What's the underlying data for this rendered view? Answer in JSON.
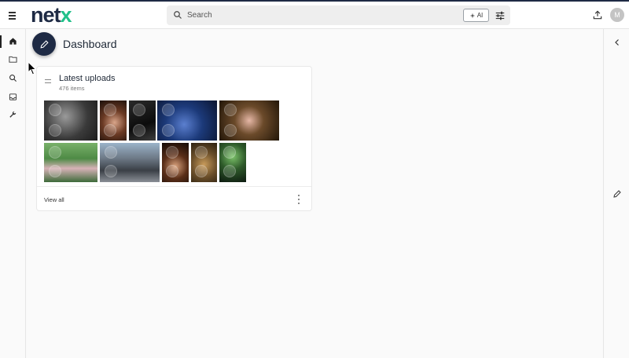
{
  "header": {
    "logo_main": "net",
    "logo_accent": "x",
    "search_placeholder": "Search",
    "ai_label": "AI",
    "avatar_initial": "M"
  },
  "sidebar": {
    "items": [
      {
        "icon": "home-icon",
        "active": true
      },
      {
        "icon": "folder-icon"
      },
      {
        "icon": "search-icon"
      },
      {
        "icon": "inbox-icon"
      },
      {
        "icon": "wrench-icon"
      }
    ]
  },
  "page": {
    "title": "Dashboard"
  },
  "widget": {
    "title": "Latest uploads",
    "count_label": "476 items",
    "view_all_label": "View all"
  },
  "colors": {
    "brand_dark": "#1e2a44",
    "brand_accent": "#22c08a"
  }
}
